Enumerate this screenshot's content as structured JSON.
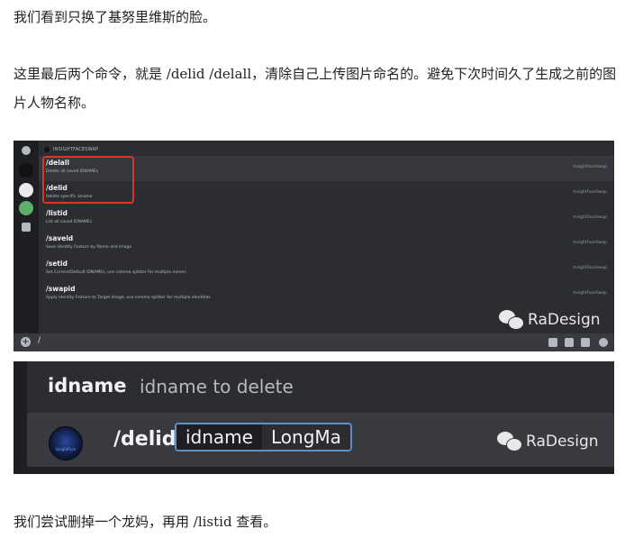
{
  "article": {
    "para1": "我们看到只换了基努里维斯的脸。",
    "para2": "这里最后两个命令，就是 /delid /delall，清除自己上传图片命名的。避免下次时间久了生成之前的图片人物名称。",
    "para3": "我们尝试删掉一个龙妈，再用 /listid 查看。"
  },
  "shot1": {
    "app_header": "INSIGHTFACESWAP",
    "commands": [
      {
        "name": "/delall",
        "desc": "Delete all saved IDNAMEs",
        "source": "InsightFaceSwap"
      },
      {
        "name": "/delid",
        "desc": "Delete specific idname",
        "source": "InsightFaceSwap"
      },
      {
        "name": "/listid",
        "desc": "List all saved IDNAMEs",
        "source": "InsightFaceSwap"
      },
      {
        "name": "/saveid",
        "desc": "Save identity Feature by Name and Image",
        "source": "InsightFaceSwap"
      },
      {
        "name": "/setid",
        "desc": "Set Current/Default IDNAMEs, use comma splitter for multiple names",
        "source": "InsightFaceSwap"
      },
      {
        "name": "/swapid",
        "desc": "Apply Identity Feature to Target Image, use comma splitter for multiple identities",
        "source": "InsightFaceSwap"
      }
    ],
    "input_text": "/",
    "watermark": "RaDesign"
  },
  "shot2": {
    "hint_name": "idname",
    "hint_desc": "idname to delete",
    "avatar_text": "InsightFace",
    "command": "/delid",
    "option_key": "idname",
    "option_value": "LongMa",
    "watermark": "RaDesign"
  },
  "colors": {
    "discord_bg": "#313338",
    "highlight_red": "#d9352b",
    "option_border": "#5e8fc9"
  },
  "icons": [
    "clock-icon",
    "discord-home-icon",
    "server-icon",
    "server-icon",
    "edit-icon",
    "add-icon",
    "gift-icon",
    "gif-icon",
    "sticker-icon",
    "emoji-icon",
    "wechat-icon"
  ]
}
